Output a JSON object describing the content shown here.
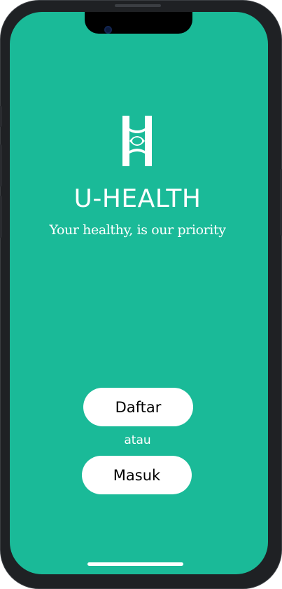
{
  "app": {
    "title": "U-HEALTH",
    "tagline": "Your healthy, is our priority",
    "logo_icon": "h-eye-logo-icon"
  },
  "actions": {
    "register_label": "Daftar",
    "separator_text": "atau",
    "login_label": "Masuk"
  },
  "theme": {
    "background": "#1aba98",
    "button_bg": "#ffffff",
    "text_light": "#ffffff",
    "button_text": "#000000"
  }
}
